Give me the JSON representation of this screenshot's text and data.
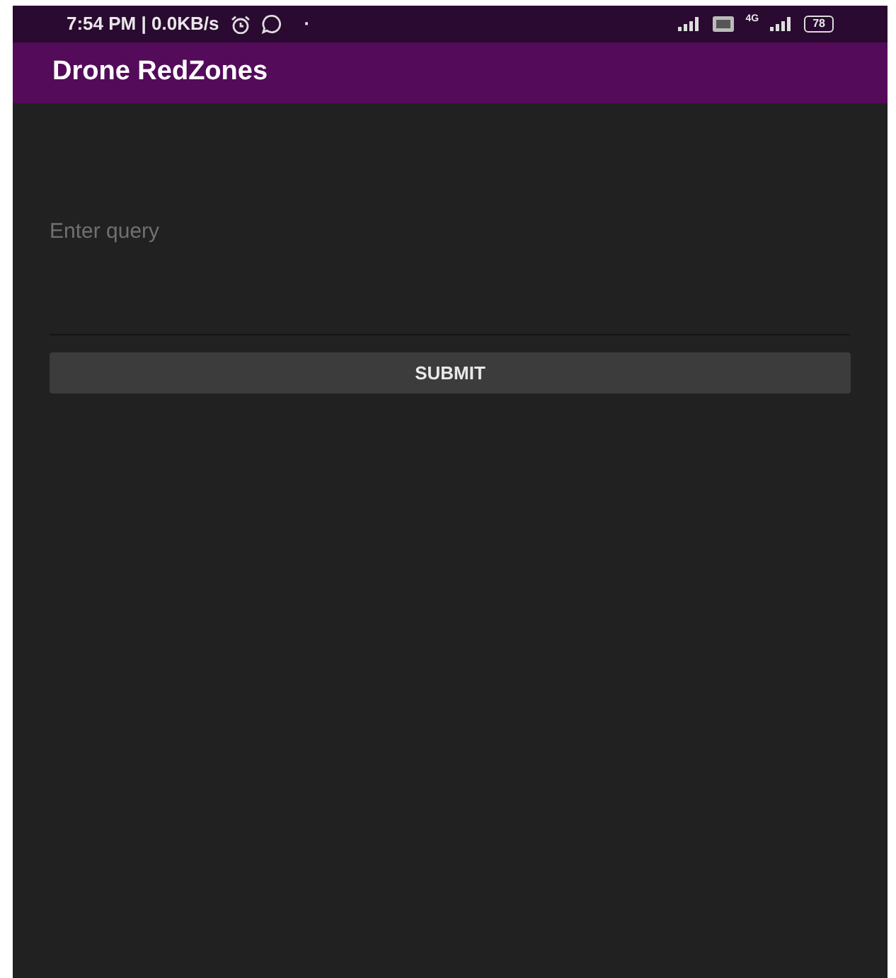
{
  "status_bar": {
    "time": "7:54 PM | 0.0KB/s",
    "dot": "·",
    "network": "4G",
    "battery": "78"
  },
  "app_bar": {
    "title": "Drone RedZones"
  },
  "query_field": {
    "placeholder": "Enter query"
  },
  "submit_button": {
    "label": "SUBMIT"
  }
}
